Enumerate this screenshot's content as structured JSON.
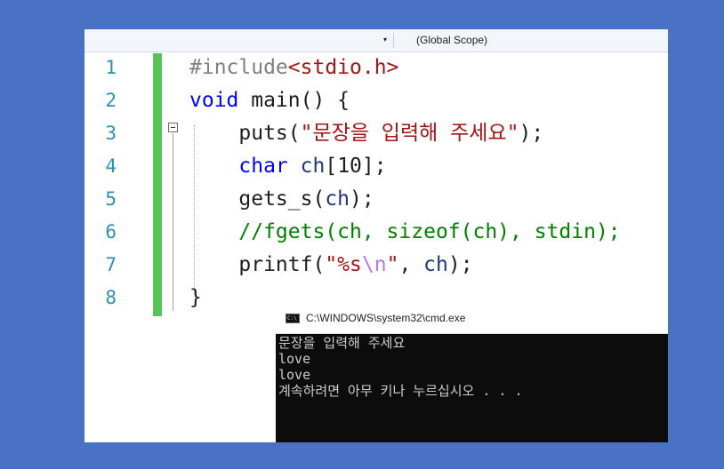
{
  "toolbar": {
    "dropdown_arrow": "▾",
    "scope_label": "(Global Scope)"
  },
  "editor": {
    "line_numbers": [
      "1",
      "2",
      "3",
      "4",
      "5",
      "6",
      "7",
      "8"
    ],
    "lines": [
      {
        "parts": [
          {
            "c": "pp",
            "t": "#include"
          },
          {
            "c": "str",
            "t": "<stdio.h>"
          }
        ]
      },
      {
        "parts": [
          {
            "c": "kw",
            "t": "void"
          },
          {
            "c": "",
            "t": " main() {"
          }
        ]
      },
      {
        "parts": [
          {
            "c": "",
            "t": "    puts("
          },
          {
            "c": "str",
            "t": "\"문장을 입력해 주세요\""
          },
          {
            "c": "",
            "t": ");"
          }
        ]
      },
      {
        "parts": [
          {
            "c": "kw",
            "t": "    char"
          },
          {
            "c": "",
            "t": " "
          },
          {
            "c": "id",
            "t": "ch"
          },
          {
            "c": "",
            "t": "[10];"
          }
        ]
      },
      {
        "parts": [
          {
            "c": "",
            "t": "    gets_s("
          },
          {
            "c": "id",
            "t": "ch"
          },
          {
            "c": "",
            "t": ");"
          }
        ]
      },
      {
        "parts": [
          {
            "c": "cmt",
            "t": "    //fgets(ch, sizeof(ch), stdin);"
          }
        ]
      },
      {
        "parts": [
          {
            "c": "",
            "t": "    printf("
          },
          {
            "c": "str",
            "t": "\"%s"
          },
          {
            "c": "esc",
            "t": "\\n"
          },
          {
            "c": "str",
            "t": "\""
          },
          {
            "c": "",
            "t": ", "
          },
          {
            "c": "id",
            "t": "ch"
          },
          {
            "c": "",
            "t": ");"
          }
        ]
      },
      {
        "parts": [
          {
            "c": "",
            "t": "}"
          }
        ]
      }
    ]
  },
  "console": {
    "title": "C:\\WINDOWS\\system32\\cmd.exe",
    "lines": [
      "문장을 입력해 주세요",
      "love",
      "love",
      "계속하려면 아무 키나 누르십시오 . . ."
    ]
  }
}
